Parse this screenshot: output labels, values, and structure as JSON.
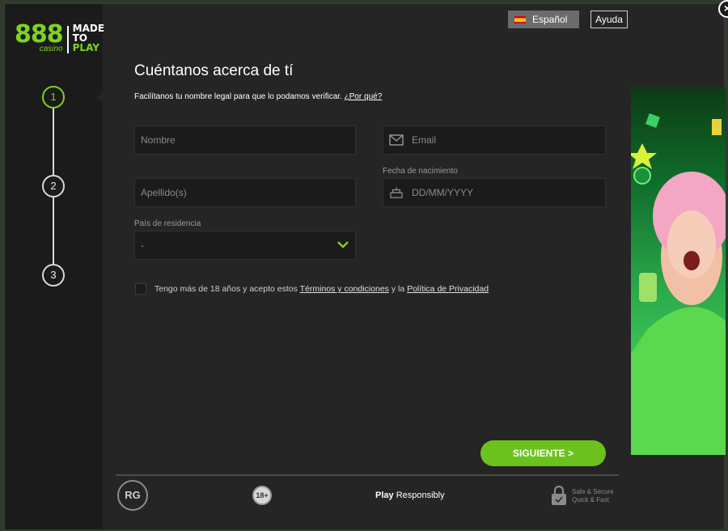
{
  "header": {
    "language_label": "Español",
    "help_label": "Ayuda",
    "close_label": "×"
  },
  "logo": {
    "number": "888",
    "sub": "casino",
    "tagline_1": "MADE",
    "tagline_2": "TO",
    "tagline_3": "PLAY"
  },
  "steps": [
    "1",
    "2",
    "3"
  ],
  "form": {
    "title": "Cuéntanos acerca de tí",
    "subtitle": "Facilítanos tu nombre legal para que lo podamos verificar.",
    "why_link": "¿Por qué?",
    "first_name_placeholder": "Nombre",
    "email_placeholder": "Email",
    "last_name_placeholder": "Apellido(s)",
    "dob_label": "Fecha de nacimiento",
    "dob_placeholder": "DD/MM/YYYY",
    "country_label": "País de residencia",
    "country_value": "-",
    "terms_prefix": "Tengo más de 18 años y acepto estos",
    "terms_link": "Términos y condiciones",
    "terms_mid": "y la",
    "privacy_link": "Política de Privacidad",
    "next_label": "SIGUIENTE >"
  },
  "footer": {
    "rg_label": "RG",
    "age_label": "18+",
    "play_bold": "Play",
    "play_rest": "Responsibly",
    "secure_line_1": "Safe & Secure",
    "secure_line_2": "Quick & Fast"
  },
  "colors": {
    "accent": "#7ed321",
    "button": "#6cc21d",
    "background": "#252525",
    "sidebar": "#1b1b1b"
  }
}
